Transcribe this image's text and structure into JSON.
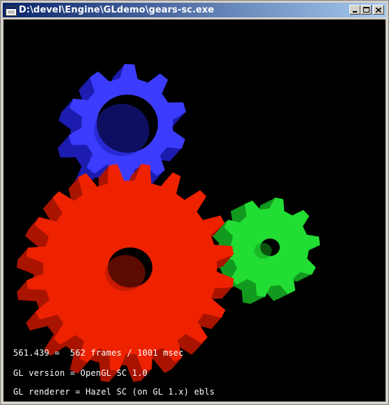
{
  "window": {
    "title": "D:\\devel\\Engine\\GLdemo\\gears-sc.exe"
  },
  "stats": {
    "fps_line": "561.439 =  562 frames / 1001 msec",
    "version_line": "GL version = OpenGL SC 1.0",
    "renderer_line": "GL renderer = Hazel SC (on GL 1.x) ebls"
  },
  "gears": [
    {
      "name": "blue",
      "color": "#3c3cff",
      "side_color": "#1c1cb0",
      "teeth": 10
    },
    {
      "name": "red",
      "color": "#ee2200",
      "side_color": "#a81400",
      "teeth": 20
    },
    {
      "name": "green",
      "color": "#22dd33",
      "side_color": "#129a1e",
      "teeth": 10
    }
  ],
  "icons": [
    "app-icon",
    "minimize-icon",
    "maximize-icon",
    "close-icon"
  ]
}
